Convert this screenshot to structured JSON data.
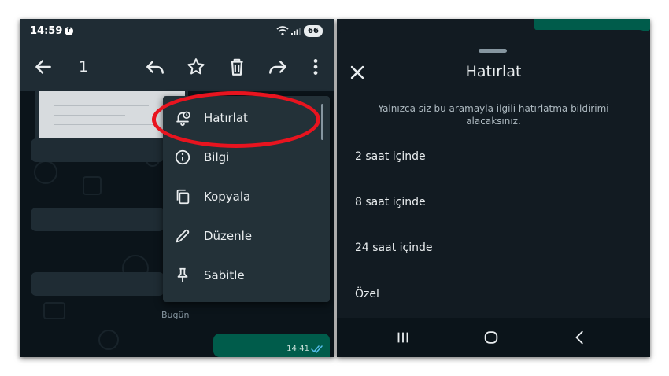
{
  "left_screen": {
    "status_bar": {
      "time": "14:59",
      "battery": "66",
      "fb_icon": "facebook-icon"
    },
    "toolbar": {
      "selected_count": "1",
      "icons": [
        "back-arrow-icon",
        "reply-icon",
        "star-icon",
        "delete-icon",
        "forward-icon",
        "more-vert-icon"
      ]
    },
    "menu": {
      "items": [
        {
          "label": "Hatırlat",
          "icon": "reminder-bell-icon"
        },
        {
          "label": "Bilgi",
          "icon": "info-icon"
        },
        {
          "label": "Kopyala",
          "icon": "copy-icon"
        },
        {
          "label": "Düzenle",
          "icon": "edit-pencil-icon"
        },
        {
          "label": "Sabitle",
          "icon": "pin-icon"
        }
      ]
    },
    "chat": {
      "date_label": "Bugün",
      "message_time": "14:41"
    }
  },
  "right_screen": {
    "sheet": {
      "title": "Hatırlat",
      "description": "Yalnızca siz bu aramayla ilgili hatırlatma bildirimi alacaksınız.",
      "options": [
        "2 saat içinde",
        "8 saat içinde",
        "24 saat içinde",
        "Özel"
      ]
    },
    "nav_bar": {
      "icons": [
        "recent-apps-icon",
        "home-icon",
        "back-nav-icon"
      ]
    }
  },
  "colors": {
    "highlight_annotation": "#e8141f",
    "outgoing_bubble": "#005c4b",
    "toolbar": "#1f2c34",
    "menu_background": "#233138",
    "sheet_background": "#121b22"
  }
}
